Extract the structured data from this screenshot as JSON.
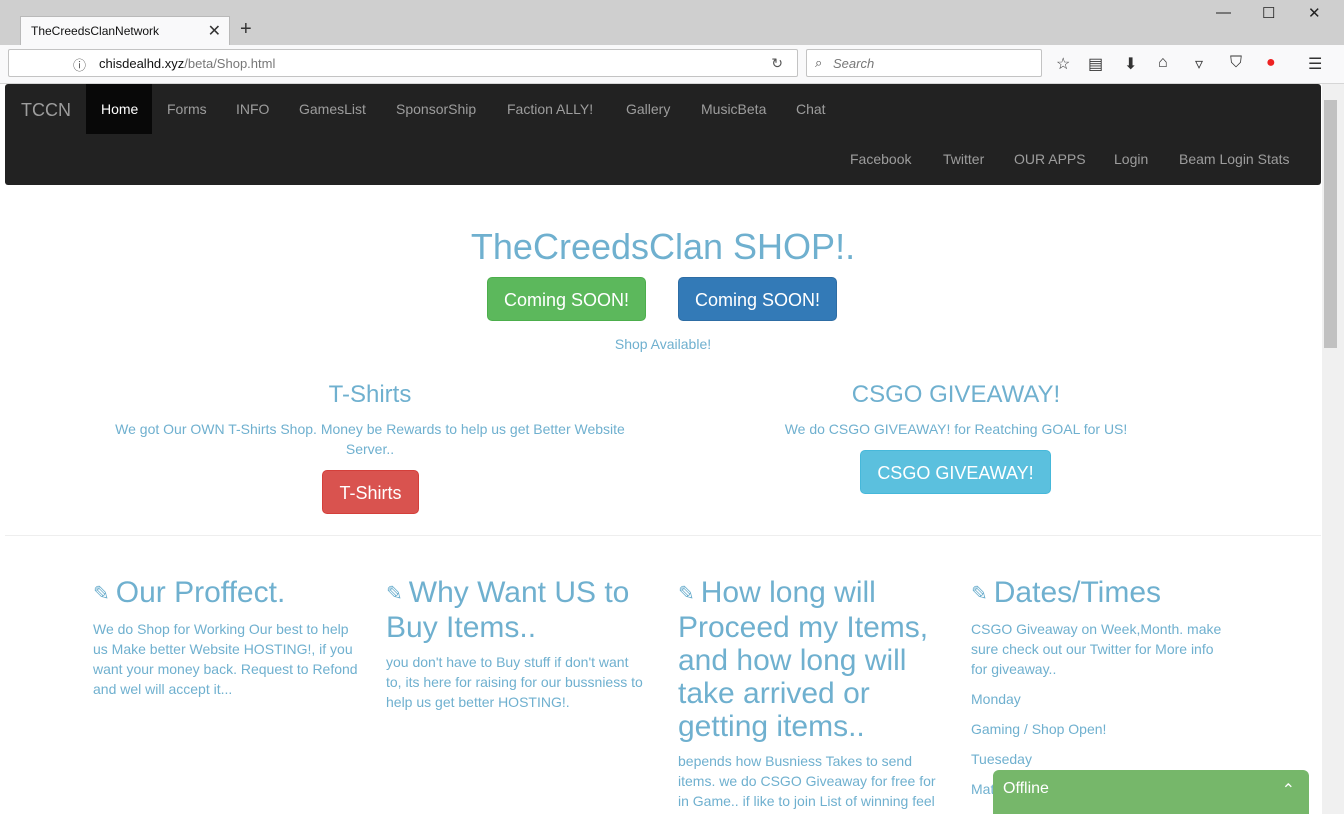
{
  "browser": {
    "tab_title": "TheCreedsClanNetwork",
    "tab_close": "✕",
    "new_tab": "+",
    "url_host": "chisdealhd.xyz",
    "url_path": "/beta/Shop.html",
    "search_placeholder": "Search"
  },
  "site_nav": {
    "brand": "TCCN",
    "items": [
      "Home",
      "Forms",
      "INFO",
      "GamesList",
      "SponsorShip",
      "Faction ALLY!",
      "Gallery",
      "MusicBeta",
      "Chat"
    ],
    "right_items": [
      "Facebook",
      "Twitter",
      "OUR APPS",
      "Login",
      "Beam Login Stats"
    ]
  },
  "hero": {
    "title": "TheCreedsClan SHOP!.",
    "btn_green": "Coming SOON!",
    "btn_blue": "Coming SOON!",
    "shop_available": "Shop Available!"
  },
  "tshirts": {
    "title": "T-Shirts",
    "text": "We got Our OWN T-Shirts Shop. Money be Rewards to help us get Better Website Server..",
    "button": "T-Shirts"
  },
  "csgo": {
    "title": "CSGO GIVEAWAY!",
    "text": "We do CSGO GIVEAWAY! for Reatching GOAL for US!",
    "button": "CSGO GIVEAWAY!"
  },
  "features": [
    {
      "title": "Our Proffect.",
      "text": "We do Shop for Working Our best to help us Make better Website HOSTING!, if you want your money back. Request to Refond and wel will accept it..."
    },
    {
      "title": "Why Want US to Buy Items..",
      "text": "you don't have to Buy stuff if don't want to, its here for raising for our bussniess to help us get better HOSTING!."
    },
    {
      "title": "How long will Proceed my Items, and how long will take arrived or getting items..",
      "text": "bepends how Busniess Takes to send items. we do CSGO Giveaway for free for in Game.. if like to join List of winning feel"
    },
    {
      "title": "Dates/Times",
      "text": "CSGO Giveaway on Week,Month. make sure check out our Twitter for More info for giveaway..",
      "lines": [
        "Monday",
        "Gaming / Shop Open!",
        "Tueseday",
        "Mat"
      ]
    }
  ],
  "chat": {
    "label": "Offline",
    "chevron": "⌃"
  },
  "colors": {
    "text_accent": "#6fb0cf",
    "green": "#5cb85c",
    "blue": "#337ab7",
    "red": "#d9534f",
    "cyan": "#5bc0de",
    "nav_bg": "#222222"
  }
}
